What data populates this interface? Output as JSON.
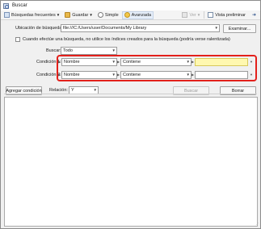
{
  "window": {
    "title": "Buscar"
  },
  "toolbar": {
    "favorites_label": "Búsquedas frecuentes",
    "save_label": "Guardar",
    "simple_label": "Simple",
    "advanced_label": "Avanzada",
    "display_label": "Ver",
    "preview_label": "Vista preliminar"
  },
  "location": {
    "label": "Ubicación de búsqueda:",
    "value": "file:///C:/Users/user/Documents/My Library",
    "browse_label": "Examinar..."
  },
  "index_option": {
    "label": "Cuando efectúe una búsqueda, no utilice los índices creados para la búsqueda (podría verse ralentizada)",
    "checked": false
  },
  "search_target": {
    "label": "Buscar:",
    "value": "Todo"
  },
  "conditions": [
    {
      "label": "Condición 1:",
      "field": "Nombre",
      "operator": "Contiene",
      "value": "",
      "highlight_color": "#fff8b0"
    },
    {
      "label": "Condición 2:",
      "field": "Nombre",
      "operator": "Contiene",
      "value": ""
    }
  ],
  "highlight_color": "#e3201b",
  "add_condition_label": "Agregar condición",
  "relation": {
    "label": "Relación:",
    "value": "Y"
  },
  "search_button_label": "Buscar",
  "clear_button_label": "Borrar"
}
